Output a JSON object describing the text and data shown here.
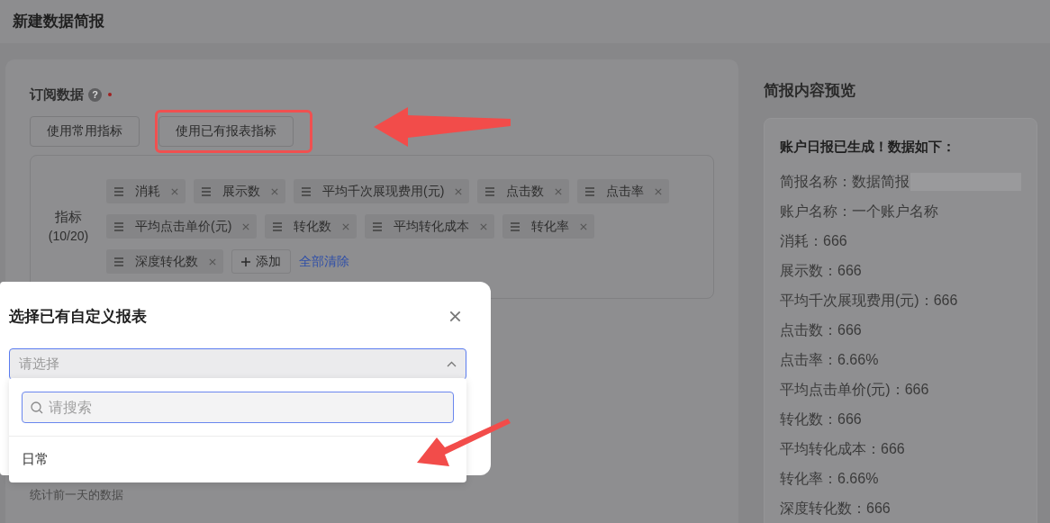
{
  "page": {
    "title": "新建数据简报"
  },
  "subscription": {
    "label": "订阅数据",
    "help_icon": "?",
    "required": true,
    "buttons": [
      {
        "label": "使用常用指标",
        "highlighted": false
      },
      {
        "label": "使用已有报表指标",
        "highlighted": true
      }
    ],
    "metrics": {
      "label": "指标",
      "count": "(10/20)",
      "tags": [
        "消耗",
        "展示数",
        "平均千次展现费用(元)",
        "点击数",
        "点击率",
        "平均点击单价(元)",
        "转化数",
        "平均转化成本",
        "转化率",
        "深度转化数"
      ],
      "add_button": "添加",
      "clear_link": "全部清除"
    },
    "note": "统计前一天的数据"
  },
  "preview": {
    "title": "简报内容预览",
    "heading": "账户日报已生成！数据如下：",
    "lines": [
      {
        "text": "简报名称：数据简报",
        "redacted": true
      },
      {
        "text": "账户名称：一个账户名称",
        "redacted": false
      },
      {
        "text": "消耗：666",
        "redacted": false
      },
      {
        "text": "展示数：666",
        "redacted": false
      },
      {
        "text": "平均千次展现费用(元)：666",
        "redacted": false
      },
      {
        "text": "点击数：666",
        "redacted": false
      },
      {
        "text": "点击率：6.66%",
        "redacted": false
      },
      {
        "text": "平均点击单价(元)：666",
        "redacted": false
      },
      {
        "text": "转化数：666",
        "redacted": false
      },
      {
        "text": "平均转化成本：666",
        "redacted": false
      },
      {
        "text": "转化率：6.66%",
        "redacted": false
      },
      {
        "text": "深度转化数：666",
        "redacted": false
      }
    ]
  },
  "dialog": {
    "title": "选择已有自定义报表",
    "select": {
      "placeholder": "请选择",
      "expanded": true
    },
    "search": {
      "placeholder": "请搜索"
    },
    "options": [
      {
        "label": "日常",
        "selected": false
      }
    ]
  }
}
